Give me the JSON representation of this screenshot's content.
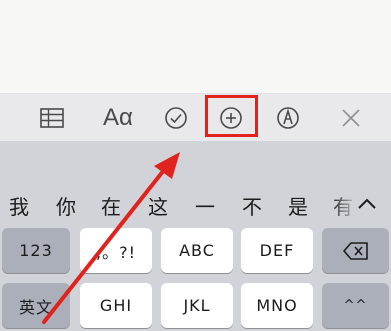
{
  "toolbar": {
    "items": [
      {
        "icon": "table-icon"
      },
      {
        "icon": "text-format-icon",
        "label": "Aα"
      },
      {
        "icon": "checklist-icon"
      },
      {
        "icon": "add-circle-icon"
      },
      {
        "icon": "markup-pen-icon"
      },
      {
        "icon": "close-icon"
      }
    ],
    "highlight_color": "#e0231d"
  },
  "candidates": [
    "我",
    "你",
    "在",
    "这",
    "一",
    "不",
    "是",
    "有"
  ],
  "keyboard": {
    "row1": [
      "123",
      ",。?!",
      "ABC",
      "DEF"
    ],
    "row2": [
      "英文",
      "GHI",
      "JKL",
      "MNO",
      "^^"
    ],
    "delete_icon": "backspace-icon",
    "expand_icon": "chevron-up-icon"
  },
  "annotation": {
    "arrow_color": "#e0231d"
  }
}
